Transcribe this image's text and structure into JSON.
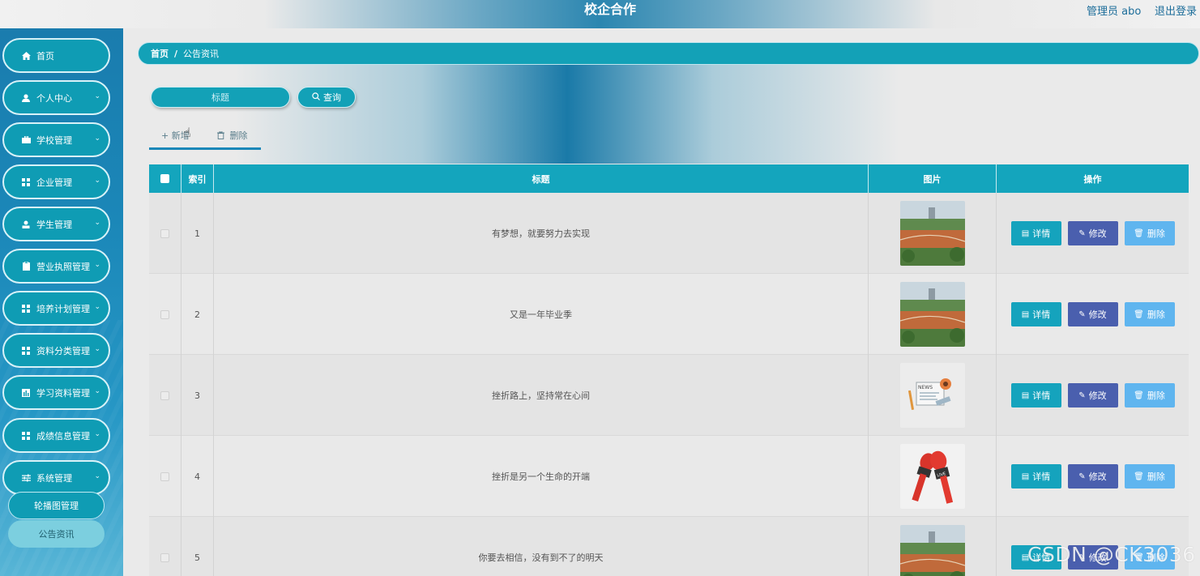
{
  "header": {
    "title": "校企合作",
    "admin": "管理员 abo",
    "logout": "退出登录"
  },
  "sidebar": {
    "items": [
      {
        "label": "首页",
        "icon": "home-icon",
        "has_arrow": false
      },
      {
        "label": "个人中心",
        "icon": "user-icon",
        "has_arrow": true
      },
      {
        "label": "学校管理",
        "icon": "briefcase-icon",
        "has_arrow": true
      },
      {
        "label": "企业管理",
        "icon": "grid-icon",
        "has_arrow": true
      },
      {
        "label": "学生管理",
        "icon": "person-icon",
        "has_arrow": true
      },
      {
        "label": "营业执照管理",
        "icon": "clipboard-icon",
        "has_arrow": true
      },
      {
        "label": "培养计划管理",
        "icon": "grid-icon",
        "has_arrow": true
      },
      {
        "label": "资料分类管理",
        "icon": "grid-icon",
        "has_arrow": true
      },
      {
        "label": "学习资料管理",
        "icon": "chart-icon",
        "has_arrow": true
      },
      {
        "label": "成绩信息管理",
        "icon": "grid-icon",
        "has_arrow": true
      },
      {
        "label": "系统管理",
        "icon": "sliders-icon",
        "has_arrow": true
      }
    ],
    "sub_items": [
      {
        "label": "轮播图管理"
      },
      {
        "label": "公告资讯"
      }
    ]
  },
  "breadcrumb": {
    "home": "首页",
    "separator": "/",
    "current": "公告资讯"
  },
  "search": {
    "placeholder": "标题",
    "button_label": "查询"
  },
  "actions": {
    "add_label": "+ 新增",
    "delete_label": "删除"
  },
  "table": {
    "columns": [
      "索引",
      "标题",
      "图片",
      "操作"
    ],
    "rows": [
      {
        "index": "1",
        "title": "有梦想，就要努力去实现",
        "image": "campus-photo"
      },
      {
        "index": "2",
        "title": "又是一年毕业季",
        "image": "campus-photo"
      },
      {
        "index": "3",
        "title": "挫折路上，坚持常在心间",
        "image": "news-illustration"
      },
      {
        "index": "4",
        "title": "挫折是另一个生命的开端",
        "image": "microphone-illustration"
      },
      {
        "index": "5",
        "title": "你要去相信，没有到不了的明天",
        "image": "campus-photo"
      }
    ],
    "row_buttons": {
      "detail": "详情",
      "edit": "修改",
      "delete": "删除"
    }
  },
  "watermark": "CSDN @CK3036",
  "colors": {
    "accent": "#13a1b7",
    "sidebar": "#1b87b8",
    "edit_button": "#4a5fae",
    "delete_button": "#5fb5ef"
  }
}
